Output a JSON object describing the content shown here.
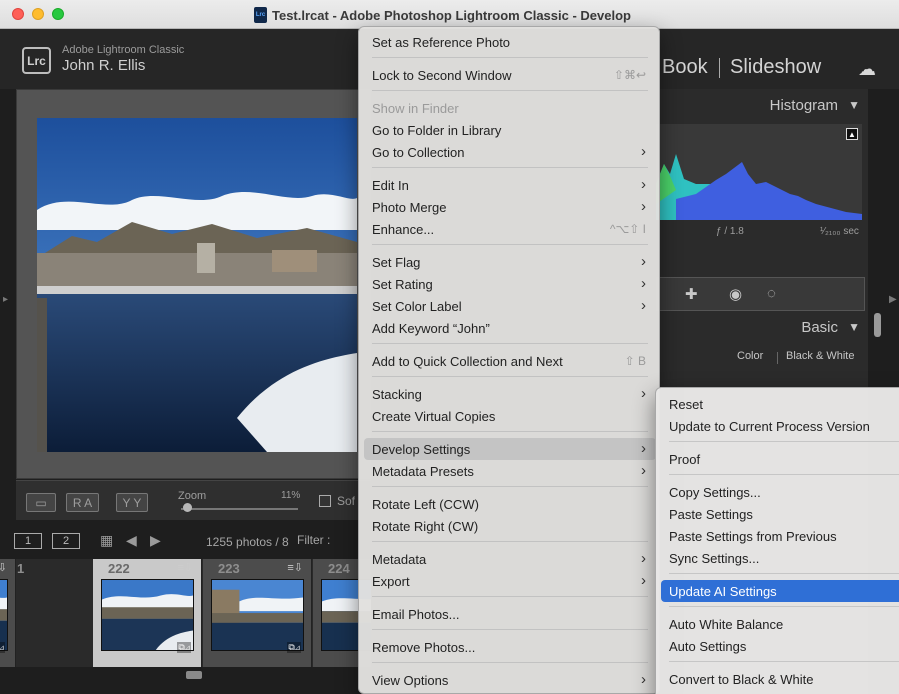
{
  "window": {
    "title": "Test.lrcat - Adobe Photoshop Lightroom Classic - Develop"
  },
  "identity": {
    "app_name": "Adobe Lightroom Classic",
    "user_name": "John R. Ellis",
    "logo_text": "Lrc"
  },
  "modules": {
    "book": "Book",
    "slideshow": "Slideshow"
  },
  "right_panel": {
    "histogram_title": "Histogram",
    "aperture": "ƒ / 1.8",
    "shutter": "¹⁄₂₁₀₀ sec",
    "basic_title": "Basic",
    "treatment_color": "Color",
    "treatment_bw": "Black & White"
  },
  "toolbar": {
    "zoom_label": "Zoom",
    "zoom_value": "11%",
    "soft_label": "Sof",
    "flag_rating": "R A",
    "yy": "Y Y"
  },
  "filmstrip_bar": {
    "view1": "1",
    "view2": "2",
    "photo_count": "1255 photos / 8",
    "filter_label": "Filter :"
  },
  "filmstrip": [
    {
      "number": "1",
      "selected": false
    },
    {
      "number": "222",
      "selected": true
    },
    {
      "number": "223",
      "selected": false
    },
    {
      "number": "224",
      "selected": false
    }
  ],
  "context_menu": {
    "items": [
      {
        "label": "Set as Reference Photo"
      },
      {
        "label": "Lock to Second Window",
        "shortcut": "⇧⌘↩"
      },
      {
        "label": "Show in Finder",
        "disabled": true
      },
      {
        "label": "Go to Folder in Library"
      },
      {
        "label": "Go to Collection",
        "submenu": true
      },
      {
        "label": "Edit In",
        "submenu": true
      },
      {
        "label": "Photo Merge",
        "submenu": true
      },
      {
        "label": "Enhance...",
        "shortcut": "^⌥⇧ I"
      },
      {
        "label": "Set Flag",
        "submenu": true
      },
      {
        "label": "Set Rating",
        "submenu": true
      },
      {
        "label": "Set Color Label",
        "submenu": true
      },
      {
        "label": "Add Keyword “John”"
      },
      {
        "label": "Add to Quick Collection and Next",
        "shortcut": "⇧ B"
      },
      {
        "label": "Stacking",
        "submenu": true
      },
      {
        "label": "Create Virtual Copies"
      },
      {
        "label": "Develop Settings",
        "submenu": true,
        "highlighted": true
      },
      {
        "label": "Metadata Presets",
        "submenu": true
      },
      {
        "label": "Rotate Left (CCW)"
      },
      {
        "label": "Rotate Right (CW)"
      },
      {
        "label": "Metadata",
        "submenu": true
      },
      {
        "label": "Export",
        "submenu": true
      },
      {
        "label": "Email Photos..."
      },
      {
        "label": "Remove Photos..."
      },
      {
        "label": "View Options",
        "submenu": true
      }
    ]
  },
  "develop_submenu": {
    "items": [
      {
        "label": "Reset"
      },
      {
        "label": "Update to Current Process Version"
      },
      {
        "label": "Proof"
      },
      {
        "label": "Copy Settings..."
      },
      {
        "label": "Paste Settings"
      },
      {
        "label": "Paste Settings from Previous"
      },
      {
        "label": "Sync Settings..."
      },
      {
        "label": "Update AI Settings",
        "active": true
      },
      {
        "label": "Auto White Balance"
      },
      {
        "label": "Auto Settings"
      },
      {
        "label": "Convert to Black & White"
      }
    ]
  },
  "colors": {
    "highlight": "#2f6fd6",
    "menu_bg": "#e1e0de",
    "panel_bg": "#2b2b2b"
  }
}
